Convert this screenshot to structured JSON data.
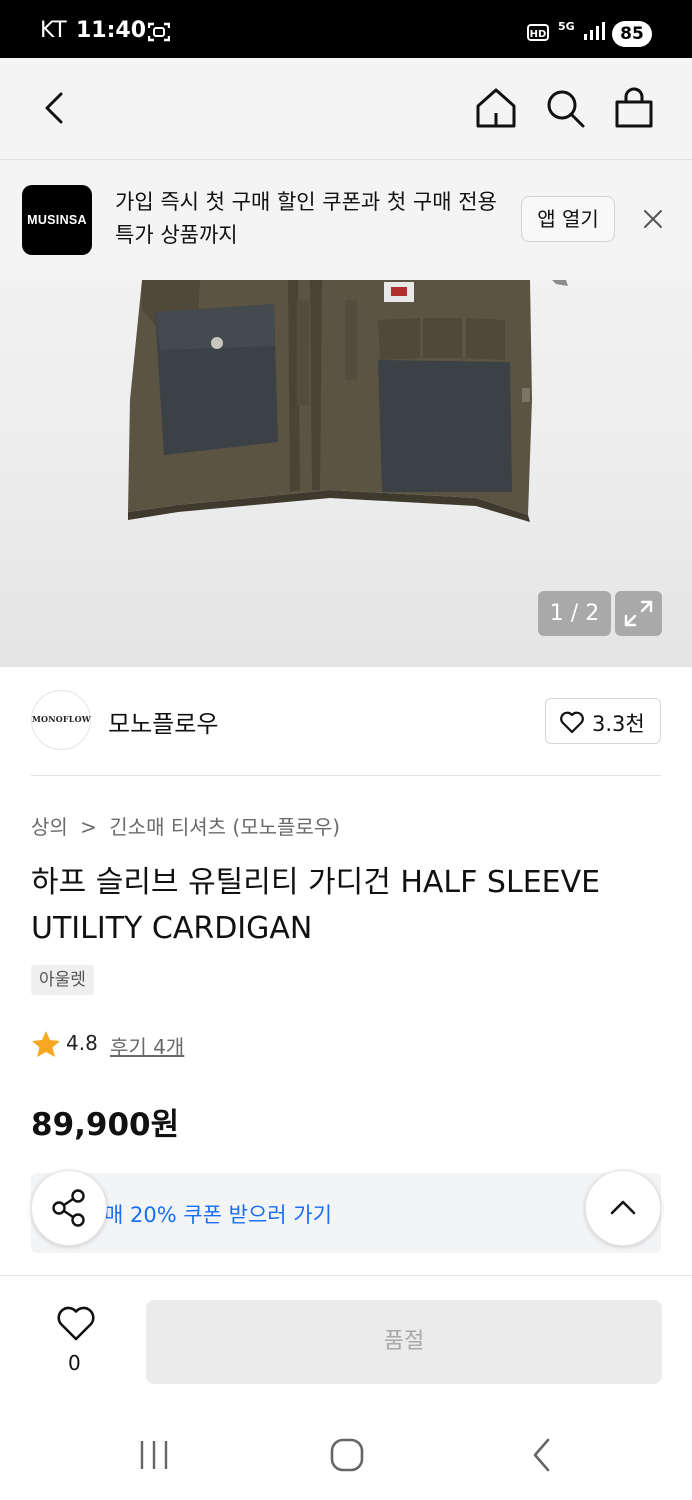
{
  "status_bar": {
    "carrier": "KT",
    "time": "11:40",
    "network": "5G",
    "hd": "HD",
    "battery": "85"
  },
  "promo": {
    "logo": "MUSINSA",
    "text": "가입 즉시 첫 구매 할인 쿠폰과 첫 구매 전용 특가 상품까지",
    "open_app_label": "앱 열기"
  },
  "gallery": {
    "counter": "1 / 2",
    "current": 1,
    "total": 2
  },
  "brand": {
    "logo_text": "MONOFLOW",
    "name": "모노플로우",
    "like_count": "3.3천"
  },
  "breadcrumb": {
    "category": "상의",
    "separator": ">",
    "subcategory": "긴소매 티셔츠 (모노플로우)"
  },
  "product": {
    "title": "하프 슬리브 유틸리티 가디건 HALF SLEEVE UTILITY CARDIGAN",
    "tag": "아울렛",
    "rating": "4.8",
    "reviews_label": "후기 4개",
    "price": "89,900원"
  },
  "coupon": {
    "text": "매 20% 쿠폰 받으러 가기"
  },
  "bottom": {
    "wish_count": "0",
    "buy_label": "품절"
  },
  "colors": {
    "coupon_blue": "#1a6ef5",
    "star": "#f7a823",
    "black": "#000000"
  },
  "icons": [
    "back-icon",
    "home-icon",
    "search-icon",
    "bag-icon",
    "close-icon",
    "expand-icon",
    "heart-icon",
    "star-icon",
    "share-icon",
    "chevron-up-icon",
    "recents-icon",
    "home-circle-icon",
    "nav-back-icon"
  ]
}
